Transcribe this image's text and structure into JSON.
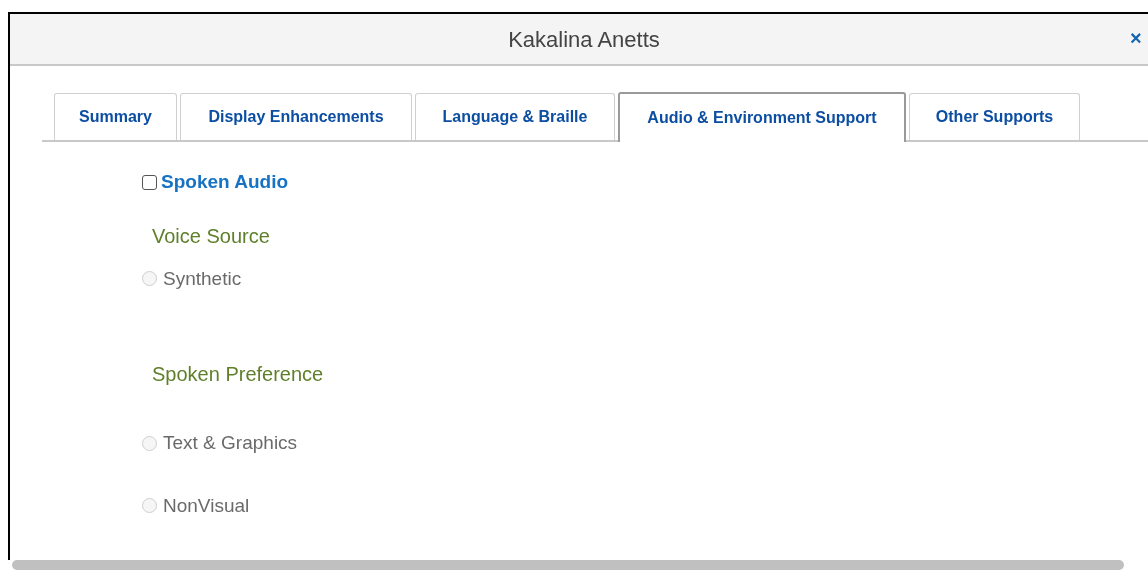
{
  "window": {
    "title": "Kakalina Anetts",
    "close": "×"
  },
  "tabs": [
    {
      "label": "Summary",
      "selected": false
    },
    {
      "label": "Display Enhancements",
      "selected": false
    },
    {
      "label": "Language & Braille",
      "selected": false
    },
    {
      "label": "Audio & Environment Support",
      "selected": true
    },
    {
      "label": "Other Supports",
      "selected": false
    }
  ],
  "spoken_audio": {
    "label": "Spoken Audio",
    "checked": false
  },
  "sections": [
    {
      "heading": "Voice Source",
      "options": [
        {
          "label": "Synthetic",
          "selected": false,
          "disabled": true
        }
      ]
    },
    {
      "heading": "Spoken Preference",
      "options": [
        {
          "label": "Text & Graphics",
          "selected": false,
          "disabled": true
        },
        {
          "label": "NonVisual",
          "selected": false,
          "disabled": true
        }
      ]
    }
  ]
}
